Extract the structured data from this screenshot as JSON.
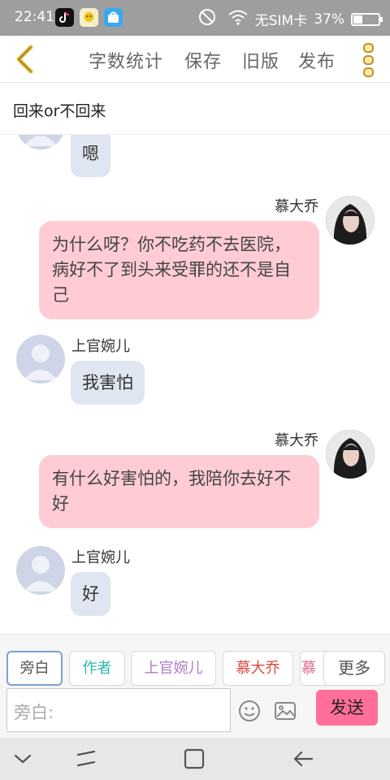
{
  "status_bar": {
    "time": "22:41",
    "carrier": "无SIM卡",
    "battery": "37%",
    "battery_level": 0.37,
    "icons": [
      "tiktok-icon",
      "app-icon-2",
      "app-icon-3",
      "no-disturb-icon",
      "wifi-icon",
      "battery-icon"
    ]
  },
  "header": {
    "word_count": "字数统计",
    "save": "保存",
    "old_version": "旧版",
    "publish": "发布"
  },
  "story_title": "回来or不回来",
  "messages": [
    {
      "side": "left",
      "name": "",
      "text": "嗯"
    },
    {
      "side": "right",
      "name": "慕大乔",
      "text": "为什么呀？你不吃药不去医院，病好不了到头来受罪的还不是自己"
    },
    {
      "side": "left",
      "name": "上官婉儿",
      "text": "我害怕"
    },
    {
      "side": "right",
      "name": "慕大乔",
      "text": "有什么好害怕的，我陪你去好不好"
    },
    {
      "side": "left",
      "name": "上官婉儿",
      "text": "好"
    }
  ],
  "roles": [
    {
      "label": "旁白",
      "color": "#555555",
      "selected": true
    },
    {
      "label": "作者",
      "color": "#2bb8a8",
      "selected": false
    },
    {
      "label": "上官婉儿",
      "color": "#b07cc6",
      "selected": false
    },
    {
      "label": "慕大乔",
      "color": "#e0483d",
      "selected": false
    },
    {
      "label": "慕",
      "color": "#e06a8a",
      "selected": false
    }
  ],
  "more_label": "更多",
  "input": {
    "placeholder": "旁白:"
  },
  "send_label": "发送",
  "colors": {
    "accent_back": "#e1b93a",
    "right_bubble": "#ffccd5",
    "left_bubble": "#dfe6f1",
    "send_button": "#ff6f9a"
  }
}
